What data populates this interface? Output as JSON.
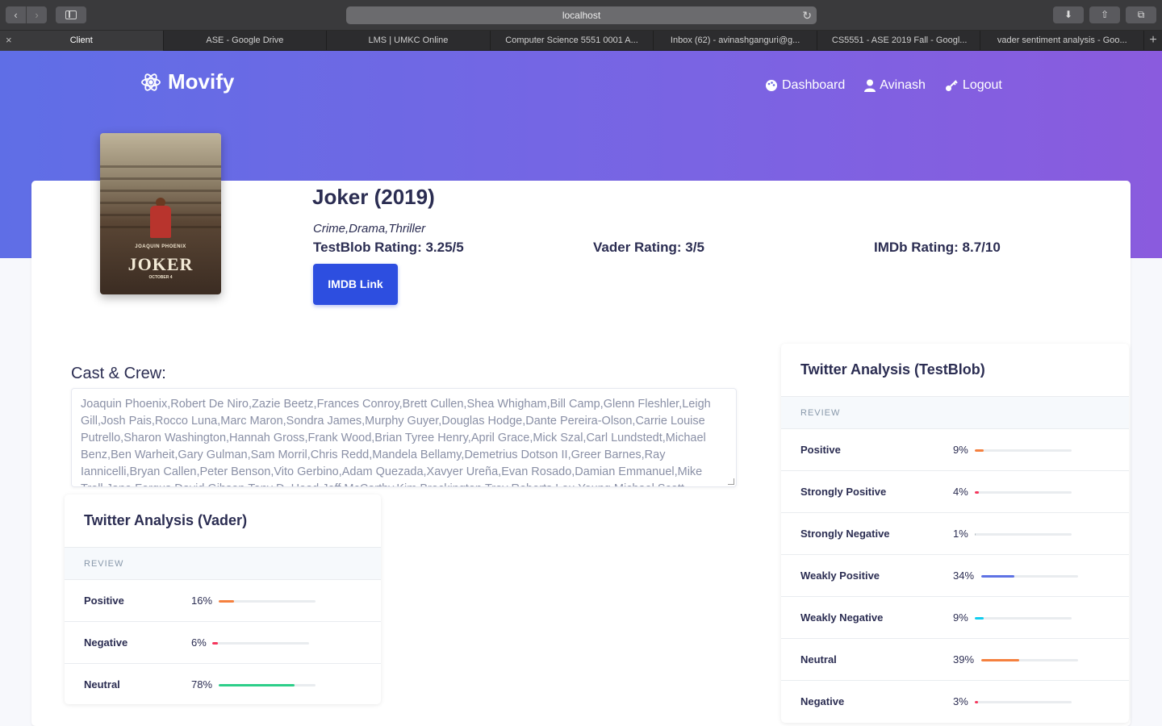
{
  "browser": {
    "url": "localhost",
    "tabs": [
      {
        "label": "Client"
      },
      {
        "label": "ASE - Google Drive"
      },
      {
        "label": "LMS | UMKC Online"
      },
      {
        "label": "Computer Science 5551 0001 A..."
      },
      {
        "label": "Inbox (62) - avinashganguri@g..."
      },
      {
        "label": "CS5551 - ASE 2019 Fall - Googl..."
      },
      {
        "label": "vader sentiment analysis - Goo..."
      }
    ]
  },
  "app": {
    "brand": "Movify",
    "nav": {
      "dashboard": "Dashboard",
      "user": "Avinash",
      "logout": "Logout"
    }
  },
  "movie": {
    "title": "Joker (2019)",
    "genres": "Crime,Drama,Thriller",
    "testblob_rating": "TestBlob Rating: 3.25/5",
    "vader_rating": "Vader Rating: 3/5",
    "imdb_rating": "IMDb Rating: 8.7/10",
    "imdb_link": "IMDB Link",
    "poster": {
      "actor": "JOAQUIN PHOENIX",
      "title": "JOKER",
      "date": "OCTOBER 4"
    }
  },
  "cast": {
    "heading": "Cast & Crew:",
    "text": "Joaquin Phoenix,Robert De Niro,Zazie Beetz,Frances Conroy,Brett Cullen,Shea Whigham,Bill Camp,Glenn Fleshler,Leigh Gill,Josh Pais,Rocco Luna,Marc Maron,Sondra James,Murphy Guyer,Douglas Hodge,Dante Pereira-Olson,Carrie Louise Putrello,Sharon Washington,Hannah Gross,Frank Wood,Brian Tyree Henry,April Grace,Mick Szal,Carl Lundstedt,Michael Benz,Ben Warheit,Gary Gulman,Sam Morril,Chris Redd,Mandela Bellamy,Demetrius Dotson II,Greer Barnes,Ray Iannicelli,Bryan Callen,Peter Benson,Vito Gerbino,Adam Quezada,Xavyer Ureña,Evan Rosado,Damian Emmanuel,Mike Troll,Jane Fergus,David Gibson,Tony D. Head,Jeff McCarthy,Kim Brockington,Troy Roberts,Lou Young,Michael Scott"
  },
  "vader": {
    "title": "Twitter Analysis (Vader)",
    "sub": "REVIEW",
    "rows": [
      {
        "label": "Positive",
        "pct": "16%",
        "value": 16,
        "color": "#f5803e"
      },
      {
        "label": "Negative",
        "pct": "6%",
        "value": 6,
        "color": "#f5365c"
      },
      {
        "label": "Neutral",
        "pct": "78%",
        "value": 78,
        "color": "#2dce89"
      }
    ]
  },
  "testblob": {
    "title": "Twitter Analysis (TestBlob)",
    "sub": "REVIEW",
    "rows": [
      {
        "label": "Positive",
        "pct": "9%",
        "value": 9,
        "color": "#f5803e"
      },
      {
        "label": "Strongly Positive",
        "pct": "4%",
        "value": 4,
        "color": "#f5365c"
      },
      {
        "label": "Strongly Negative",
        "pct": "1%",
        "value": 1,
        "color": "#adb5bd"
      },
      {
        "label": "Weakly Positive",
        "pct": "34%",
        "value": 34,
        "color": "#5e72e4"
      },
      {
        "label": "Weakly Negative",
        "pct": "9%",
        "value": 9,
        "color": "#11cdef"
      },
      {
        "label": "Neutral",
        "pct": "39%",
        "value": 39,
        "color": "#f5803e"
      },
      {
        "label": "Negative",
        "pct": "3%",
        "value": 3,
        "color": "#f5365c"
      }
    ]
  }
}
